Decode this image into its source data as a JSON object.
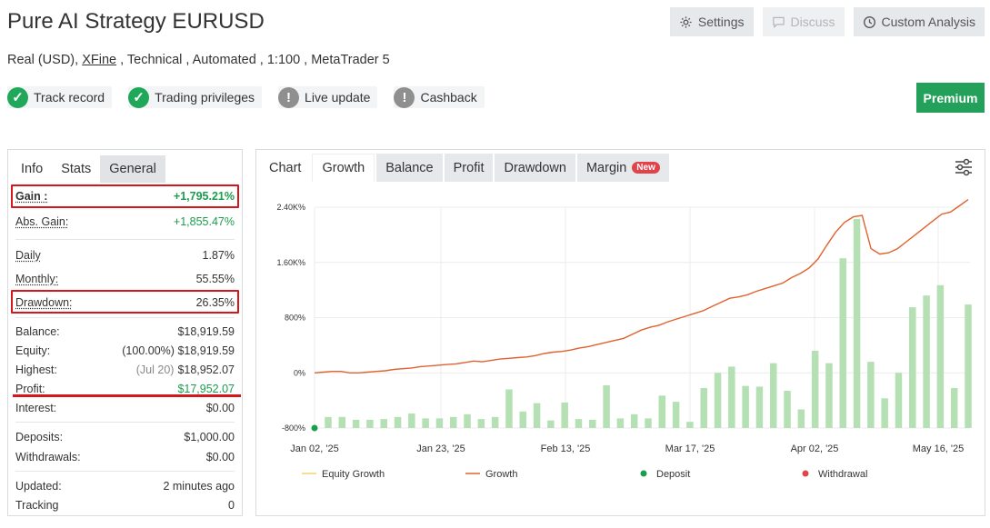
{
  "header": {
    "title": "Pure AI Strategy EURUSD",
    "settings_label": "Settings",
    "discuss_label": "Discuss",
    "custom_analysis_label": "Custom Analysis",
    "subtitle_pre": "Real (USD), ",
    "subtitle_link": "XFine",
    "subtitle_post": " , Technical , Automated , 1:100 , MetaTrader 5"
  },
  "badges": [
    {
      "label": "Track record",
      "icon": "check-circle-icon",
      "status": "ok"
    },
    {
      "label": "Trading privileges",
      "icon": "check-circle-icon",
      "status": "ok"
    },
    {
      "label": "Live update",
      "icon": "exclamation-circle-icon",
      "status": "warn"
    },
    {
      "label": "Cashback",
      "icon": "exclamation-circle-icon",
      "status": "warn"
    }
  ],
  "premium_label": "Premium",
  "left_tabs": [
    "Info",
    "Stats",
    "General"
  ],
  "stats": {
    "gain": {
      "label": "Gain :",
      "value": "+1,795.21%"
    },
    "abs_gain": {
      "label": "Abs. Gain:",
      "value": "+1,855.47%"
    },
    "daily": {
      "label": "Daily",
      "value": "1.87%"
    },
    "monthly": {
      "label": "Monthly:",
      "value": "55.55%"
    },
    "drawdown": {
      "label": "Drawdown:",
      "value": "26.35%"
    },
    "balance": {
      "label": "Balance:",
      "value": "$18,919.59"
    },
    "equity": {
      "label": "Equity:",
      "muted": "(100.00%)",
      "value": "$18,919.59"
    },
    "highest": {
      "label": "Highest:",
      "muted": "(Jul 20)",
      "value": "$18,952.07"
    },
    "profit": {
      "label": "Profit:",
      "value": "$17,952.07"
    },
    "interest": {
      "label": "Interest:",
      "value": "$0.00"
    },
    "deposits": {
      "label": "Deposits:",
      "value": "$1,000.00"
    },
    "withdrawals": {
      "label": "Withdrawals:",
      "value": "$0.00"
    },
    "updated": {
      "label": "Updated:",
      "value": "2 minutes ago"
    },
    "tracking": {
      "label": "Tracking",
      "value": "0"
    }
  },
  "chart_tabs": [
    "Chart",
    "Growth",
    "Balance",
    "Profit",
    "Drawdown",
    "Margin"
  ],
  "new_badge": "New",
  "colors": {
    "accent_green": "#23a05a",
    "value_green": "#1a9d4c",
    "highlight_red": "#d3171b",
    "growth_line": "#e0622f",
    "bar_green": "#b5e0b3",
    "equity_line": "#f2d46a",
    "deposit": "#1a9d4c",
    "withdrawal": "#e0434a"
  },
  "chart_data": {
    "type": "line",
    "y_ticks": [
      "2.40K%",
      "1.60K%",
      "800%",
      "0%",
      "-800%"
    ],
    "y_tick_values": [
      2400,
      1600,
      800,
      0,
      -800
    ],
    "ylim": [
      -800,
      2400
    ],
    "x_ticks": [
      "Jan 02, '25",
      "Jan 23, '25",
      "Feb 13, '25",
      "Mar 17, '25",
      "Apr 02, '25",
      "May 16, '25"
    ],
    "series": [
      {
        "name": "Growth",
        "values": [
          0,
          10,
          20,
          20,
          0,
          0,
          10,
          20,
          30,
          50,
          60,
          70,
          90,
          100,
          110,
          120,
          130,
          150,
          170,
          160,
          180,
          200,
          210,
          220,
          230,
          250,
          280,
          300,
          310,
          330,
          360,
          380,
          410,
          440,
          470,
          500,
          560,
          620,
          660,
          690,
          740,
          780,
          820,
          860,
          900,
          960,
          1020,
          1080,
          1100,
          1130,
          1180,
          1220,
          1260,
          1300,
          1380,
          1440,
          1520,
          1650,
          1850,
          2040,
          2180,
          2260,
          2280,
          1800,
          1720,
          1740,
          1800,
          1900,
          2000,
          2100,
          2200,
          2300,
          2330,
          2420,
          2510
        ]
      },
      {
        "name": "bars",
        "values": [
          -640,
          -640,
          -680,
          -680,
          -670,
          -640,
          -590,
          -660,
          -660,
          -640,
          -600,
          -670,
          -640,
          -240,
          -560,
          -440,
          -690,
          -430,
          -670,
          -680,
          -180,
          -660,
          -600,
          -660,
          -330,
          -420,
          -710,
          -220,
          0,
          90,
          -190,
          -200,
          140,
          -260,
          -530,
          320,
          140,
          1660,
          2230,
          160,
          -370,
          0,
          950,
          1120,
          1270,
          -220,
          990
        ]
      }
    ],
    "legend": [
      "Equity Growth",
      "Growth",
      "Deposit",
      "Withdrawal"
    ],
    "deposit_points": [
      {
        "x_index": 0,
        "y": -800
      }
    ]
  }
}
